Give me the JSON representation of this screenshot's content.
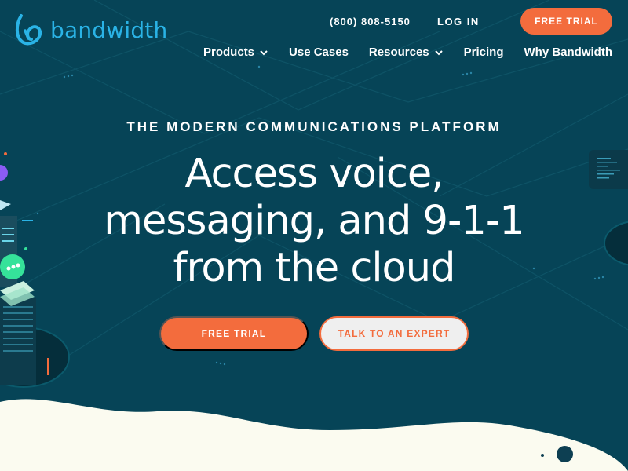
{
  "brand": {
    "name": "bandwidth",
    "color": "#2ab3e6"
  },
  "header": {
    "phone": "(800) 808-5150",
    "login": "LOG IN",
    "trial_button": "FREE TRIAL"
  },
  "nav": {
    "items": [
      {
        "label": "Products",
        "has_dropdown": true
      },
      {
        "label": "Use Cases",
        "has_dropdown": false
      },
      {
        "label": "Resources",
        "has_dropdown": true
      },
      {
        "label": "Pricing",
        "has_dropdown": false
      },
      {
        "label": "Why Bandwidth",
        "has_dropdown": false
      }
    ]
  },
  "hero": {
    "eyebrow": "THE MODERN COMMUNICATIONS PLATFORM",
    "headline_lines": [
      "Access voice,",
      "messaging, and 9-1-1",
      "from the cloud"
    ],
    "primary_cta": "FREE TRIAL",
    "secondary_cta": "TALK TO AN EXPERT"
  },
  "colors": {
    "background": "#064457",
    "accent": "#f36c3d",
    "wave": "#fbfbf0"
  },
  "icons": [
    "bandwidth-logo-icon",
    "chevron-down-icon"
  ]
}
